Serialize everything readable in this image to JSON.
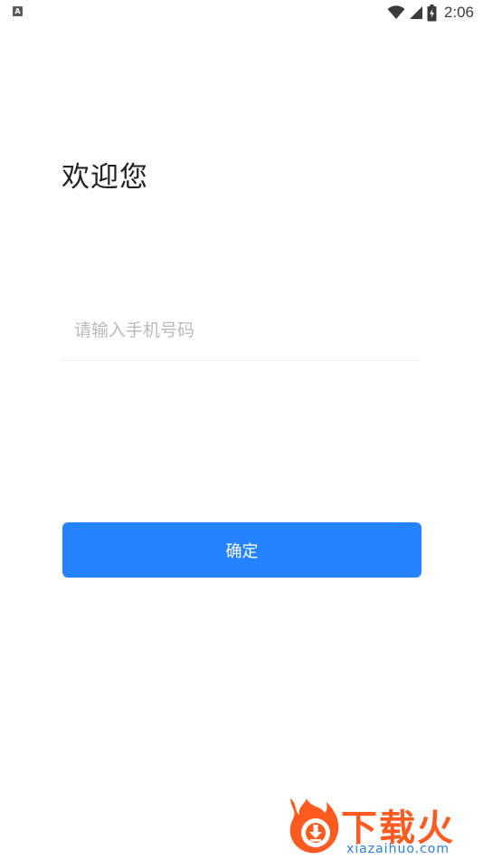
{
  "status_bar": {
    "left_icon_letter": "A",
    "left_icon": "keyboard-a-icon",
    "wifi_icon": "wifi-icon",
    "signal_icon": "cell-signal-icon",
    "battery_icon": "battery-charging-icon",
    "time": "2:06"
  },
  "title": "欢迎您",
  "phone_input": {
    "value": "",
    "placeholder": "请输入手机号码"
  },
  "confirm_button": {
    "label": "确定",
    "color": "#2683ff"
  },
  "watermark": {
    "text": "下载火",
    "domain": "xiazaihuo.com",
    "accent_color": "#ff5a1f",
    "domain_color": "#2d7fe0"
  }
}
